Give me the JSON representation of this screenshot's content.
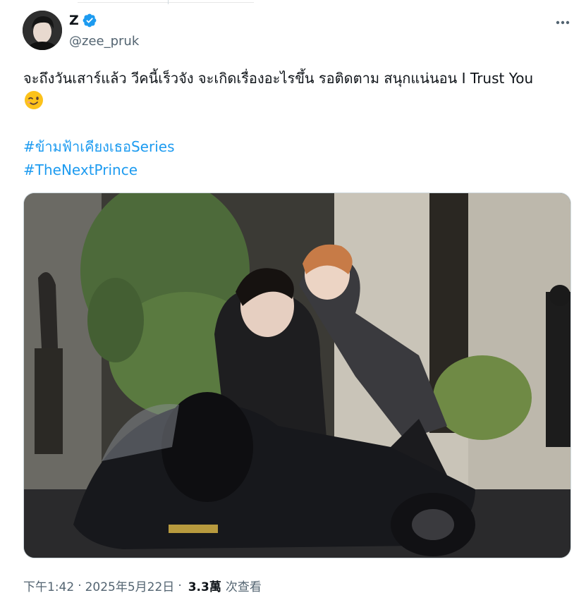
{
  "tweet": {
    "display_name": "Z",
    "handle": "@zee_pruk",
    "text": "จะถึงวันเสาร์แล้ว วีคนี้เร็วจัง จะเกิดเรื่องอะไรขึ้น  รอติดตาม สนุกแน่นอน I Trust You",
    "emoji": "winking-face",
    "hashtags": [
      "#ข้ามฟ้าเคียงเธอSeries",
      "#TheNextPrince"
    ],
    "time": "下午1:42",
    "separator": "·",
    "date": "2025年5月22日",
    "views": "3.3萬",
    "views_label": "次查看"
  },
  "colors": {
    "link": "#1d9bf0",
    "verified": "#1d9bf0",
    "secondary_text": "#536471"
  }
}
